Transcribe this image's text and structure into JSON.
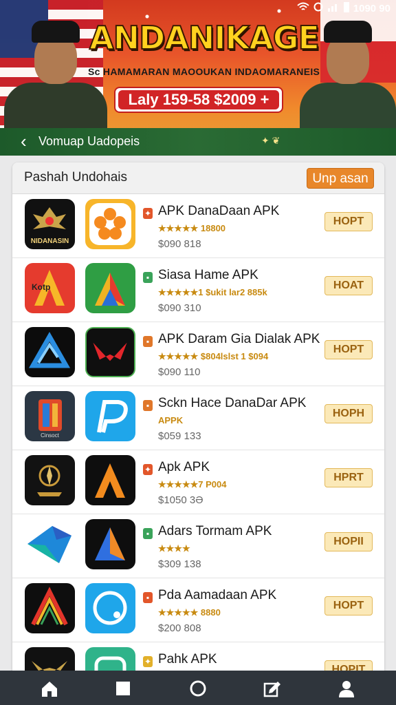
{
  "status": {
    "time": "1090 90"
  },
  "banner": {
    "title": "ANDANIKAGE",
    "subtitle": "Sc HAMAMARAN MAOOUKAN INDAOMARANEIS",
    "pill": "Laly 159-58 $2009 +"
  },
  "nav": {
    "title": "Vomuap Uadopeis"
  },
  "section": {
    "title": "Pashah Undohais",
    "button": "Unp asan"
  },
  "apps": [
    {
      "name": "APK DanaDaan APK",
      "meta": "★★★★★ 18800",
      "price": "$090 818",
      "button": "HOPT",
      "tile_label": "NIDANASIN"
    },
    {
      "name": "Siasa Hame APK",
      "meta": "★★★★★1 $ukit lar2 885k",
      "price": "$090 310",
      "button": "HOAT",
      "tile_label": "Kotp"
    },
    {
      "name": "APK Daram Gia Dialak APK",
      "meta": "★★★★★ $804lslst 1 $094",
      "price": "$090 110",
      "button": "HOPT",
      "tile_label": ""
    },
    {
      "name": "Sckn Hace DanaDar APK",
      "meta": "APPK",
      "price": "$059 133",
      "button": "HOPH",
      "tile_label": "Cinsoct"
    },
    {
      "name": "Apk APK",
      "meta": "★★★★★7 P004",
      "price": "$1050 3Ə",
      "button": "HPRT",
      "tile_label": ""
    },
    {
      "name": "Adars Tormam APK",
      "meta": "★★★★",
      "price": "$309 138",
      "button": "HOPII",
      "tile_label": ""
    },
    {
      "name": "Pda Aamadaan APK",
      "meta": "★★★★★ 8880",
      "price": "$200 808",
      "button": "HOPT",
      "tile_label": ""
    },
    {
      "name": "Pahk APK",
      "meta": "",
      "price": "",
      "button": "HOPIT",
      "tile_label": ""
    }
  ],
  "bottom_nav": [
    "home-icon",
    "square-icon",
    "circle-icon",
    "edit-icon",
    "profile-icon"
  ]
}
